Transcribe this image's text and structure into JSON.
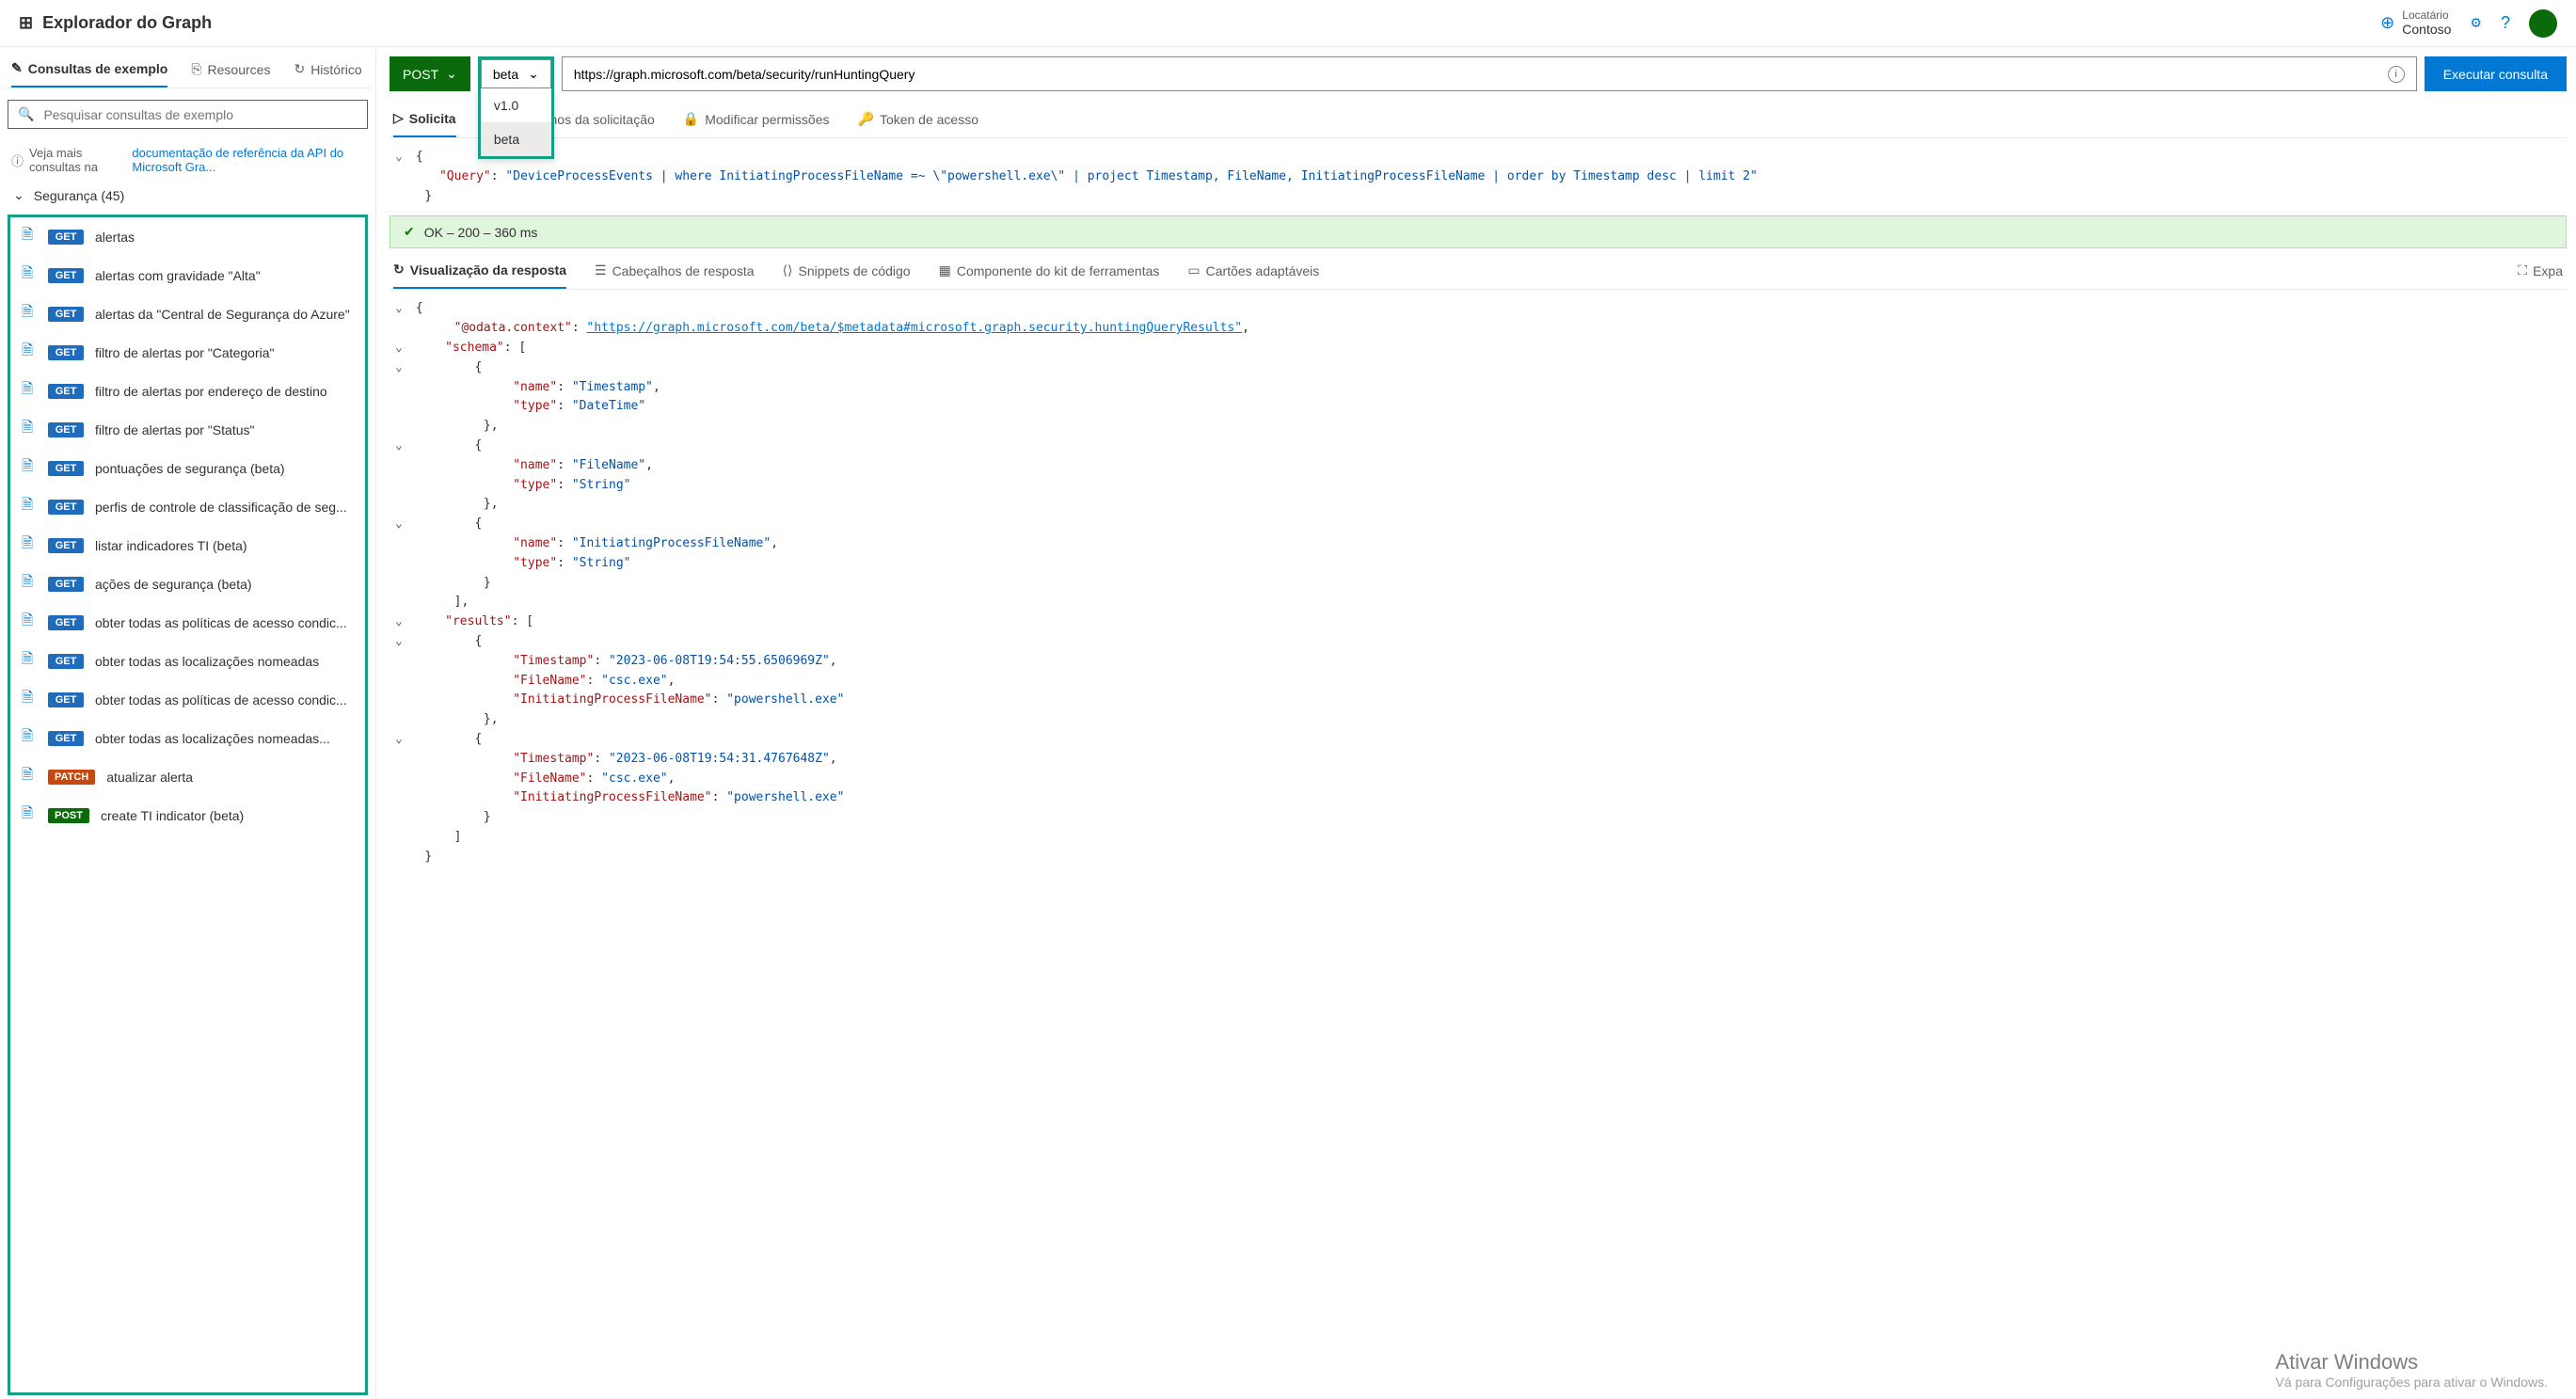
{
  "header": {
    "title": "Explorador do Graph",
    "tenant_label": "Locatário",
    "tenant_name": "Contoso"
  },
  "sidebar": {
    "tabs": {
      "samples": "Consultas de exemplo",
      "resources": "Resources",
      "history": "Histórico"
    },
    "search_placeholder": "Pesquisar consultas de exemplo",
    "doc_prefix": "Veja mais consultas na ",
    "doc_link": "documentação de referência da API do Microsoft Gra...",
    "category": "Segurança (45)",
    "queries": [
      {
        "method": "GET",
        "label": "alertas"
      },
      {
        "method": "GET",
        "label": "alertas com gravidade \"Alta\""
      },
      {
        "method": "GET",
        "label": "alertas da \"Central de Segurança do Azure\""
      },
      {
        "method": "GET",
        "label": "filtro de alertas por \"Categoria\""
      },
      {
        "method": "GET",
        "label": "filtro de alertas por endereço de destino"
      },
      {
        "method": "GET",
        "label": "filtro de alertas por \"Status\""
      },
      {
        "method": "GET",
        "label": "pontuações de segurança (beta)"
      },
      {
        "method": "GET",
        "label": "perfis de controle de classificação de seg..."
      },
      {
        "method": "GET",
        "label": "listar indicadores TI (beta)"
      },
      {
        "method": "GET",
        "label": "ações de segurança (beta)"
      },
      {
        "method": "GET",
        "label": "obter todas as políticas de acesso condic..."
      },
      {
        "method": "GET",
        "label": "obter todas as localizações nomeadas"
      },
      {
        "method": "GET",
        "label": "obter todas as políticas de acesso condic..."
      },
      {
        "method": "GET",
        "label": "obter todas as localizações nomeadas..."
      },
      {
        "method": "PATCH",
        "label": "atualizar alerta"
      },
      {
        "method": "POST",
        "label": "create TI indicator (beta)"
      }
    ]
  },
  "query_bar": {
    "method": "POST",
    "version": "beta",
    "version_options": [
      "v1.0",
      "beta"
    ],
    "url": "https://graph.microsoft.com/beta/security/runHuntingQuery",
    "run": "Executar consulta"
  },
  "request_tabs": {
    "body": "Solicita",
    "headers": "Cabeçalhos da solicitação",
    "permissions": "Modificar permissões",
    "token": "Token de acesso"
  },
  "request_body": {
    "key": "\"Query\"",
    "value": "\"DeviceProcessEvents | where InitiatingProcessFileName =~ \\\"powershell.exe\\\" | project Timestamp, FileName, InitiatingProcessFileName | order by Timestamp desc | limit 2\""
  },
  "status": "OK – 200 – 360 ms",
  "response_tabs": {
    "preview": "Visualização da resposta",
    "headers": "Cabeçalhos de resposta",
    "snippets": "Snippets de código",
    "toolkit": "Componente do kit de ferramentas",
    "cards": "Cartões adaptáveis",
    "expand": "Expa"
  },
  "response_body": {
    "context_key": "\"@odata.context\"",
    "context_val": "\"https://graph.microsoft.com/beta/$metadata#microsoft.graph.security.huntingQueryResults\"",
    "schema_key": "\"schema\"",
    "schema": [
      {
        "name_k": "\"name\"",
        "name_v": "\"Timestamp\"",
        "type_k": "\"type\"",
        "type_v": "\"DateTime\""
      },
      {
        "name_k": "\"name\"",
        "name_v": "\"FileName\"",
        "type_k": "\"type\"",
        "type_v": "\"String\""
      },
      {
        "name_k": "\"name\"",
        "name_v": "\"InitiatingProcessFileName\"",
        "type_k": "\"type\"",
        "type_v": "\"String\""
      }
    ],
    "results_key": "\"results\"",
    "results": [
      {
        "ts_k": "\"Timestamp\"",
        "ts_v": "\"2023-06-08T19:54:55.6506969Z\"",
        "fn_k": "\"FileName\"",
        "fn_v": "\"csc.exe\"",
        "ip_k": "\"InitiatingProcessFileName\"",
        "ip_v": "\"powershell.exe\""
      },
      {
        "ts_k": "\"Timestamp\"",
        "ts_v": "\"2023-06-08T19:54:31.4767648Z\"",
        "fn_k": "\"FileName\"",
        "fn_v": "\"csc.exe\"",
        "ip_k": "\"InitiatingProcessFileName\"",
        "ip_v": "\"powershell.exe\""
      }
    ]
  },
  "watermark": {
    "title": "Ativar Windows",
    "subtitle": "Vá para Configurações para ativar o Windows."
  }
}
